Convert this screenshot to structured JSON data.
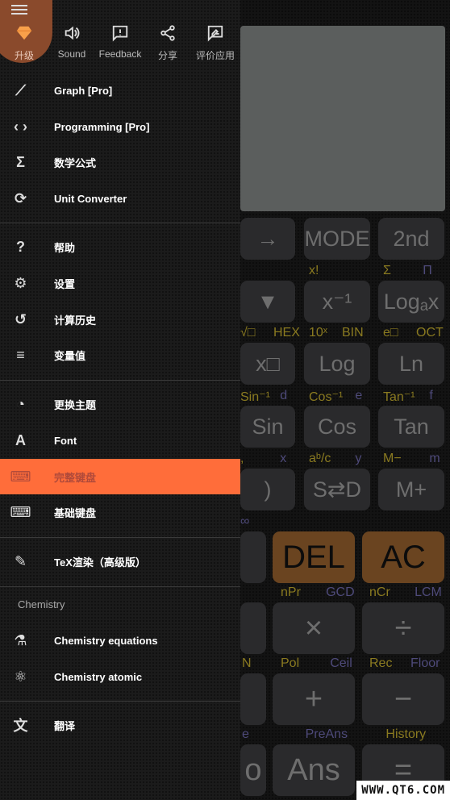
{
  "calculator": {
    "upper_keys": [
      [
        "→",
        "MODE",
        "2nd"
      ],
      [
        "▼",
        "x⁻¹",
        "Logₐx"
      ],
      [
        "x□",
        "Log",
        "Ln"
      ],
      [
        "Sin",
        "Cos",
        "Tan"
      ],
      [
        ")",
        "S⇄D",
        "M+"
      ]
    ],
    "upper_labels": [
      [],
      [
        {
          "t": "x!",
          "c": "gold",
          "col": 1
        },
        {
          "t": "Σ",
          "c": "gold",
          "col": 2
        },
        {
          "t": "Π",
          "c": "purple",
          "col": 2.6
        }
      ],
      [
        {
          "t": "√□",
          "c": "gold",
          "col": 0
        },
        {
          "t": "HEX",
          "c": "gold",
          "col": 0.5
        },
        {
          "t": "10ˣ",
          "c": "gold",
          "col": 1
        },
        {
          "t": "BIN",
          "c": "gold",
          "col": 1.5
        },
        {
          "t": "e□",
          "c": "gold",
          "col": 2
        },
        {
          "t": "OCT",
          "c": "gold",
          "col": 2.5
        }
      ],
      [
        {
          "t": "Sin⁻¹",
          "c": "gold",
          "col": 0
        },
        {
          "t": "d",
          "c": "purple",
          "col": 0.6
        },
        {
          "t": "Cos⁻¹",
          "c": "gold",
          "col": 1
        },
        {
          "t": "e",
          "c": "purple",
          "col": 1.7
        },
        {
          "t": "Tan⁻¹",
          "c": "gold",
          "col": 2
        },
        {
          "t": "f",
          "c": "purple",
          "col": 2.7
        }
      ],
      [
        {
          "t": ",",
          "c": "gold",
          "col": 0
        },
        {
          "t": "x",
          "c": "purple",
          "col": 0.6
        },
        {
          "t": "aᵇ/c",
          "c": "gold",
          "col": 1
        },
        {
          "t": "y",
          "c": "purple",
          "col": 1.7
        },
        {
          "t": "M−",
          "c": "gold",
          "col": 2
        },
        {
          "t": "m",
          "c": "purple",
          "col": 2.7
        }
      ],
      [
        {
          "t": "∞",
          "c": "purple",
          "col": 0
        }
      ]
    ],
    "lower_keys": [
      [
        "",
        "DEL",
        "AC"
      ],
      [
        "",
        "×",
        "÷"
      ],
      [
        "",
        "+",
        "−"
      ],
      [
        "o",
        "Ans",
        "="
      ]
    ],
    "lower_labels": [
      [
        {
          "t": "nPr",
          "c": "gold",
          "col": 1
        },
        {
          "t": "GCD",
          "c": "purple",
          "col": 1.55
        },
        {
          "t": "nCr",
          "c": "gold",
          "col": 2
        },
        {
          "t": "LCM",
          "c": "purple",
          "col": 2.55
        }
      ],
      [
        {
          "t": "N",
          "c": "gold",
          "col": 0
        },
        {
          "t": "Pol",
          "c": "gold",
          "col": 1
        },
        {
          "t": "Ceil",
          "c": "purple",
          "col": 1.6
        },
        {
          "t": "Rec",
          "c": "gold",
          "col": 2
        },
        {
          "t": "Floor",
          "c": "purple",
          "col": 2.5
        }
      ],
      [
        {
          "t": "e",
          "c": "purple",
          "col": 0
        },
        {
          "t": "PreAns",
          "c": "purple",
          "col": 1.3
        },
        {
          "t": "History",
          "c": "gold",
          "col": 2.2
        }
      ]
    ],
    "colors": {
      "gold": "#8a7a20",
      "purple": "#4e4a7a",
      "accent": "#ff6d3a",
      "del_ac": "#6a4420"
    }
  },
  "drawer": {
    "top_buttons": [
      {
        "label": "升级",
        "icon": "diamond-icon"
      },
      {
        "label": "Sound",
        "icon": "volume-icon"
      },
      {
        "label": "Feedback",
        "icon": "feedback-icon"
      },
      {
        "label": "分享",
        "icon": "share-icon"
      },
      {
        "label": "评价应用",
        "icon": "rate-icon"
      }
    ],
    "items": [
      {
        "label": "Graph [Pro]",
        "icon": "graph-icon",
        "glyph": "⟋"
      },
      {
        "label": "Programming [Pro]",
        "icon": "code-icon",
        "glyph": "‹ ›"
      },
      {
        "label": "数学公式",
        "icon": "sigma-icon",
        "glyph": "Σ"
      },
      {
        "label": "Unit Converter",
        "icon": "sync-icon",
        "glyph": "⟳"
      },
      {
        "label": "帮助",
        "icon": "help-icon",
        "glyph": "?"
      },
      {
        "label": "设置",
        "icon": "gear-icon",
        "glyph": "⚙"
      },
      {
        "label": "计算历史",
        "icon": "history-icon",
        "glyph": "↺"
      },
      {
        "label": "变量值",
        "icon": "list-icon",
        "glyph": "≡"
      },
      {
        "label": "更换主题",
        "icon": "palette-icon",
        "glyph": "◔"
      },
      {
        "label": "Font",
        "icon": "font-icon",
        "glyph": "A"
      },
      {
        "label": "完整键盘",
        "icon": "keyboard-icon",
        "glyph": "⌨",
        "active": true
      },
      {
        "label": "基础键盘",
        "icon": "keyboard-icon",
        "glyph": "⌨"
      },
      {
        "label": "TeX渲染（高级版）",
        "icon": "pencil-icon",
        "glyph": "✎"
      },
      {
        "label": "Chemistry equations",
        "icon": "flask-icon",
        "glyph": "⚗"
      },
      {
        "label": "Chemistry atomic",
        "icon": "atom-icon",
        "glyph": "⚛"
      },
      {
        "label": "翻译",
        "icon": "translate-icon",
        "glyph": "文"
      }
    ],
    "section_chemistry": "Chemistry"
  },
  "watermark": "WWW.QT6.COM"
}
